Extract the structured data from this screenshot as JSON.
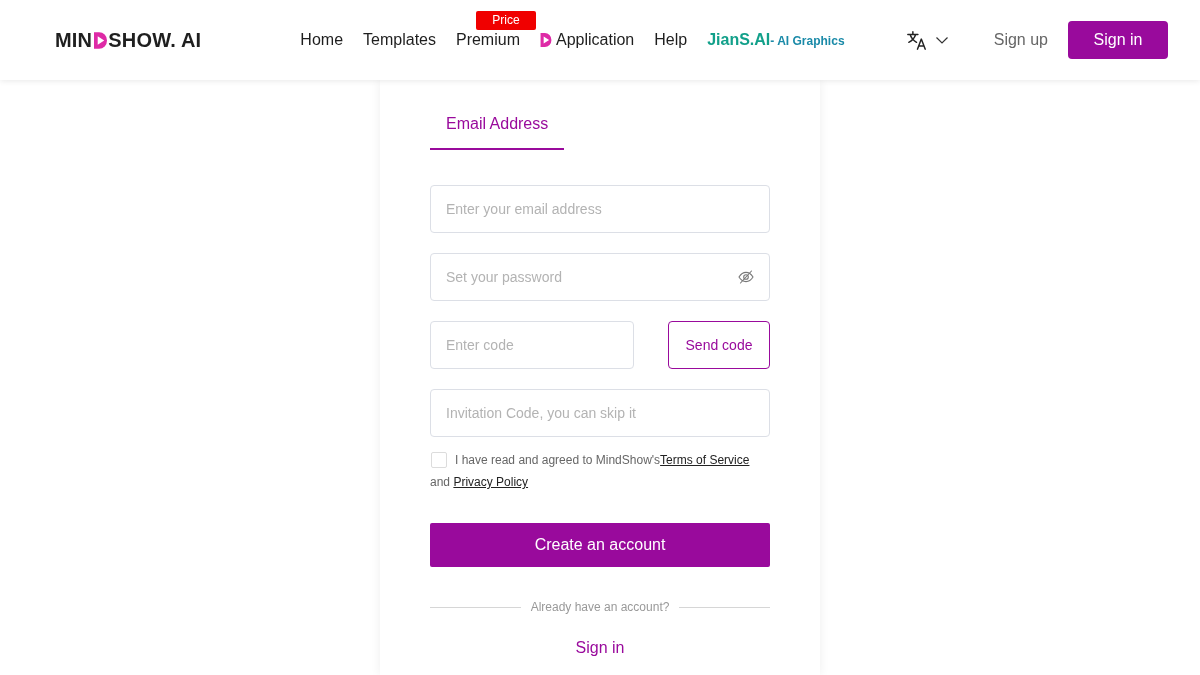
{
  "header": {
    "logo": {
      "start": "MIN",
      "end": "SHOW. AI"
    },
    "nav": [
      {
        "kind": "link",
        "label": "Home"
      },
      {
        "kind": "link",
        "label": "Templates"
      },
      {
        "kind": "badge",
        "label": "Premium",
        "badge": "Price"
      },
      {
        "kind": "icon",
        "label": "Application"
      },
      {
        "kind": "link",
        "label": "Help"
      },
      {
        "kind": "brand",
        "label": "JianS.AI",
        "tagline": "- AI Graphics"
      }
    ],
    "sign_up": "Sign up",
    "sign_in": "Sign in"
  },
  "form": {
    "tabs": [
      {
        "label": "Email Address",
        "selected": true
      }
    ],
    "fields": [
      {
        "kind": "email",
        "placeholder": "Enter your email address"
      },
      {
        "kind": "password",
        "placeholder": "Set your password"
      },
      {
        "kind": "code",
        "placeholder": "Enter code",
        "button": "Send code"
      },
      {
        "kind": "invitation",
        "placeholder": "Invitation Code, you can skip it"
      }
    ],
    "agreement": {
      "checked": false,
      "text": "I have read and agreed to MindShow's",
      "terms_link": "Terms of Service",
      "joiner": "and",
      "privacy_link": "Privacy Policy"
    },
    "submit": "Create an account",
    "divider": "Already have an account?",
    "sign_in_link": "Sign in"
  }
}
